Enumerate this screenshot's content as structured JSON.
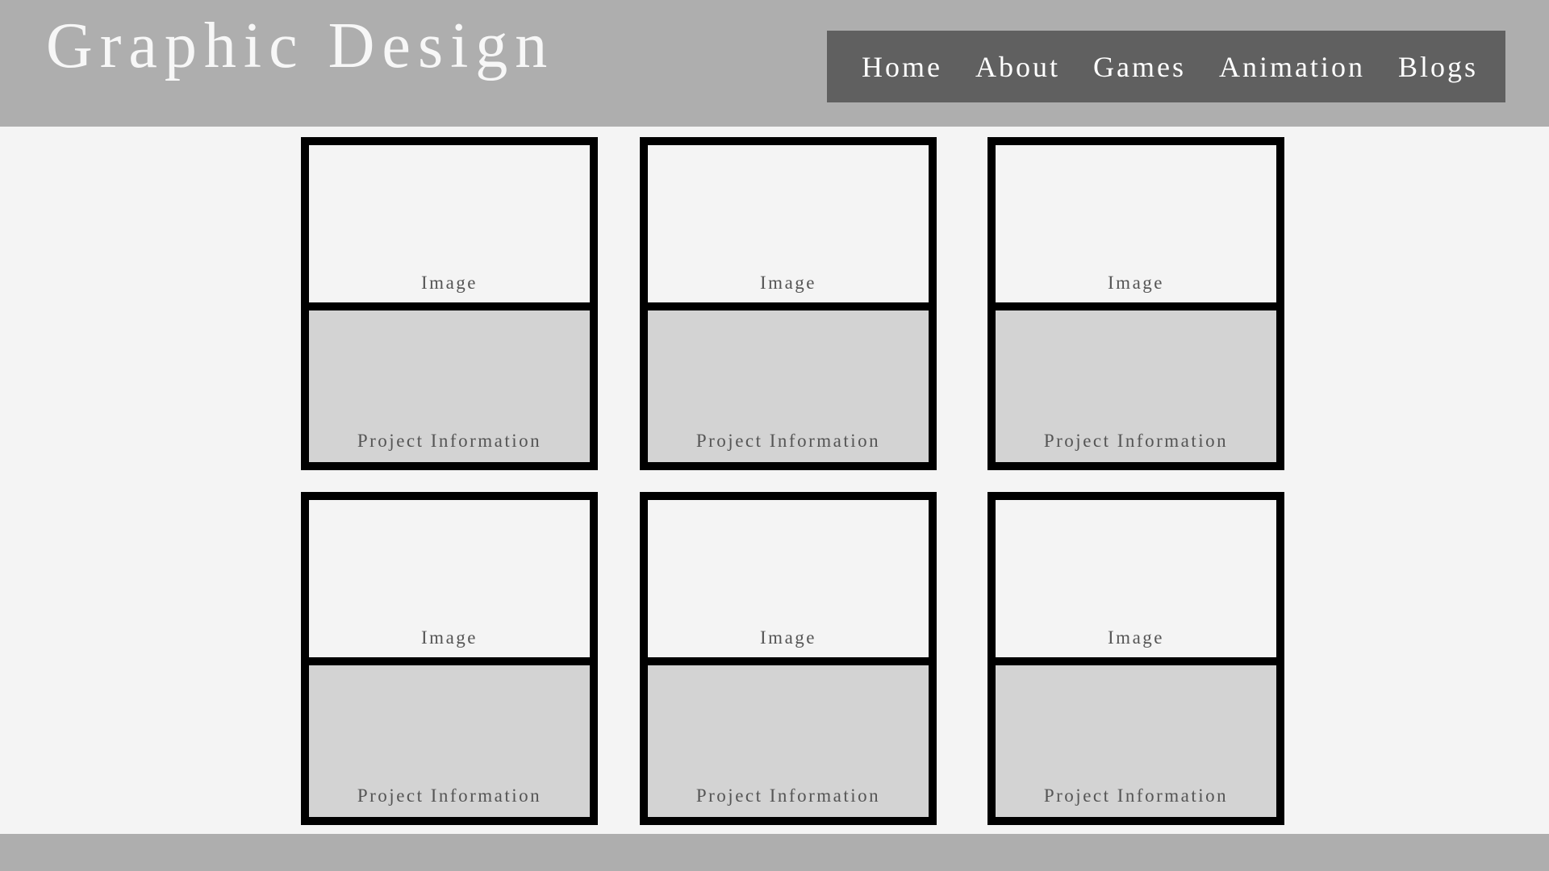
{
  "header": {
    "title": "Graphic Design",
    "nav": [
      {
        "label": "Home"
      },
      {
        "label": "About"
      },
      {
        "label": "Games"
      },
      {
        "label": "Animation"
      },
      {
        "label": "Blogs"
      }
    ]
  },
  "cards": [
    {
      "image_label": "Image",
      "info_label": "Project Information"
    },
    {
      "image_label": "Image",
      "info_label": "Project Information"
    },
    {
      "image_label": "Image",
      "info_label": "Project Information"
    },
    {
      "image_label": "Image",
      "info_label": "Project Information"
    },
    {
      "image_label": "Image",
      "info_label": "Project Information"
    },
    {
      "image_label": "Image",
      "info_label": "Project Information"
    }
  ],
  "colors": {
    "header_bg": "#aeaeae",
    "nav_bg": "#606060",
    "page_bg": "#f4f4f4",
    "card_border": "#000000",
    "info_bg": "#d3d3d3"
  }
}
